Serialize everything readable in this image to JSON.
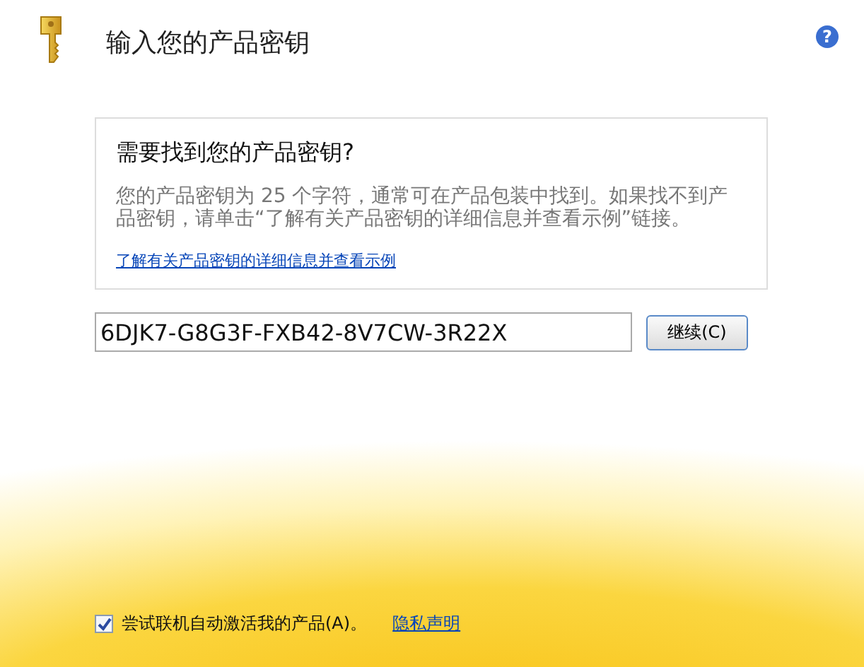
{
  "header": {
    "title": "输入您的产品密钥",
    "help": "?"
  },
  "info_box": {
    "heading": "需要找到您的产品密钥?",
    "body": "您的产品密钥为 25 个字符，通常可在产品包装中找到。如果找不到产品密钥，请单击“了解有关产品密钥的详细信息并查看示例”链接。",
    "link": "了解有关产品密钥的详细信息并查看示例"
  },
  "key_field": {
    "value": "6DJK7-G8G3F-FXB42-8V7CW-3R22X"
  },
  "continue_button": {
    "label": "继续(C)"
  },
  "footer": {
    "activate": {
      "label": "尝试联机自动激活我的产品(A)。",
      "checked": true
    },
    "privacy_link": "隐私声明"
  }
}
